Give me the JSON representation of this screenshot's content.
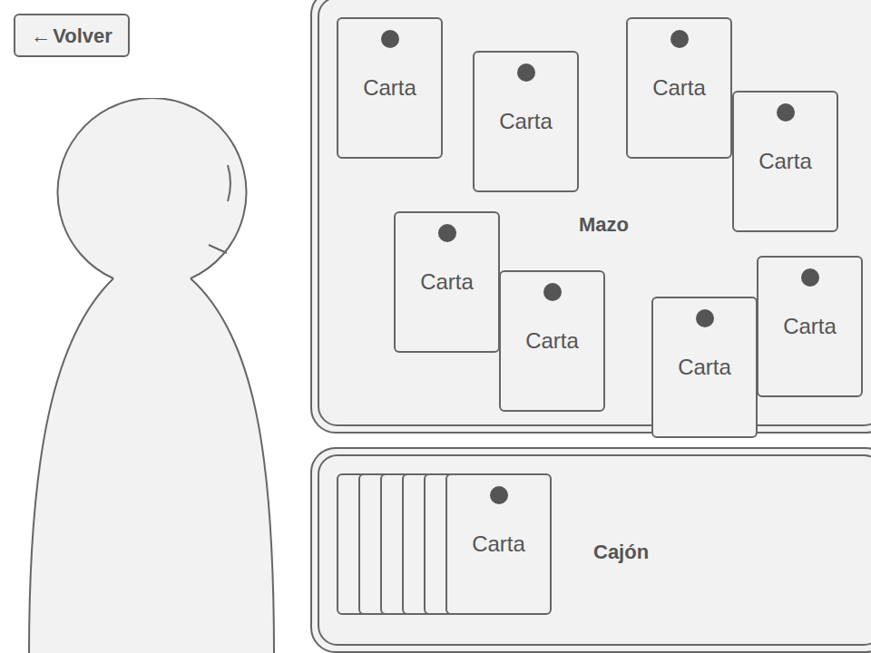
{
  "back_button": {
    "icon": "←",
    "label": "Volver"
  },
  "deck": {
    "label": "Mazo",
    "cards": [
      {
        "label": "Carta"
      },
      {
        "label": "Carta"
      },
      {
        "label": "Carta"
      },
      {
        "label": "Carta"
      },
      {
        "label": "Carta"
      },
      {
        "label": "Carta"
      },
      {
        "label": "Carta"
      },
      {
        "label": "Carta"
      }
    ]
  },
  "drawer": {
    "label": "Cajón",
    "hidden_cards": 5,
    "top_card": {
      "label": "Carta"
    }
  }
}
